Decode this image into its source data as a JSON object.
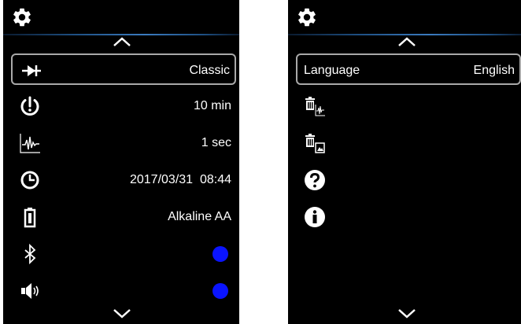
{
  "left_screen": {
    "header_icon": "gear-icon",
    "scroll_up_icon": "chevron-up-icon",
    "scroll_down_icon": "chevron-down-icon",
    "rows": [
      {
        "icon": "diode-icon",
        "value": "Classic",
        "selected": true
      },
      {
        "icon": "power-timer-icon",
        "value": "10 min"
      },
      {
        "icon": "waveform-icon",
        "value": "1 sec"
      },
      {
        "icon": "clock-icon",
        "value": "2017/03/31  08:44"
      },
      {
        "icon": "battery-icon",
        "value": "Alkaline AA"
      },
      {
        "icon": "bluetooth-icon",
        "toggle": "on"
      },
      {
        "icon": "speaker-icon",
        "toggle": "on"
      }
    ]
  },
  "right_screen": {
    "header_icon": "gear-icon",
    "scroll_up_icon": "chevron-up-icon",
    "scroll_down_icon": "chevron-down-icon",
    "rows": [
      {
        "icon": "",
        "label": "Language",
        "value": "English",
        "selected": true
      },
      {
        "icon": "delete-waveform-icon"
      },
      {
        "icon": "delete-image-icon"
      },
      {
        "icon": "help-icon"
      },
      {
        "icon": "info-icon"
      }
    ]
  },
  "colors": {
    "background": "#000000",
    "text": "#ffffff",
    "toggle_on": "#0a14ff",
    "selection_border": "#a9a9a9",
    "separator": "#3b7bbf"
  }
}
